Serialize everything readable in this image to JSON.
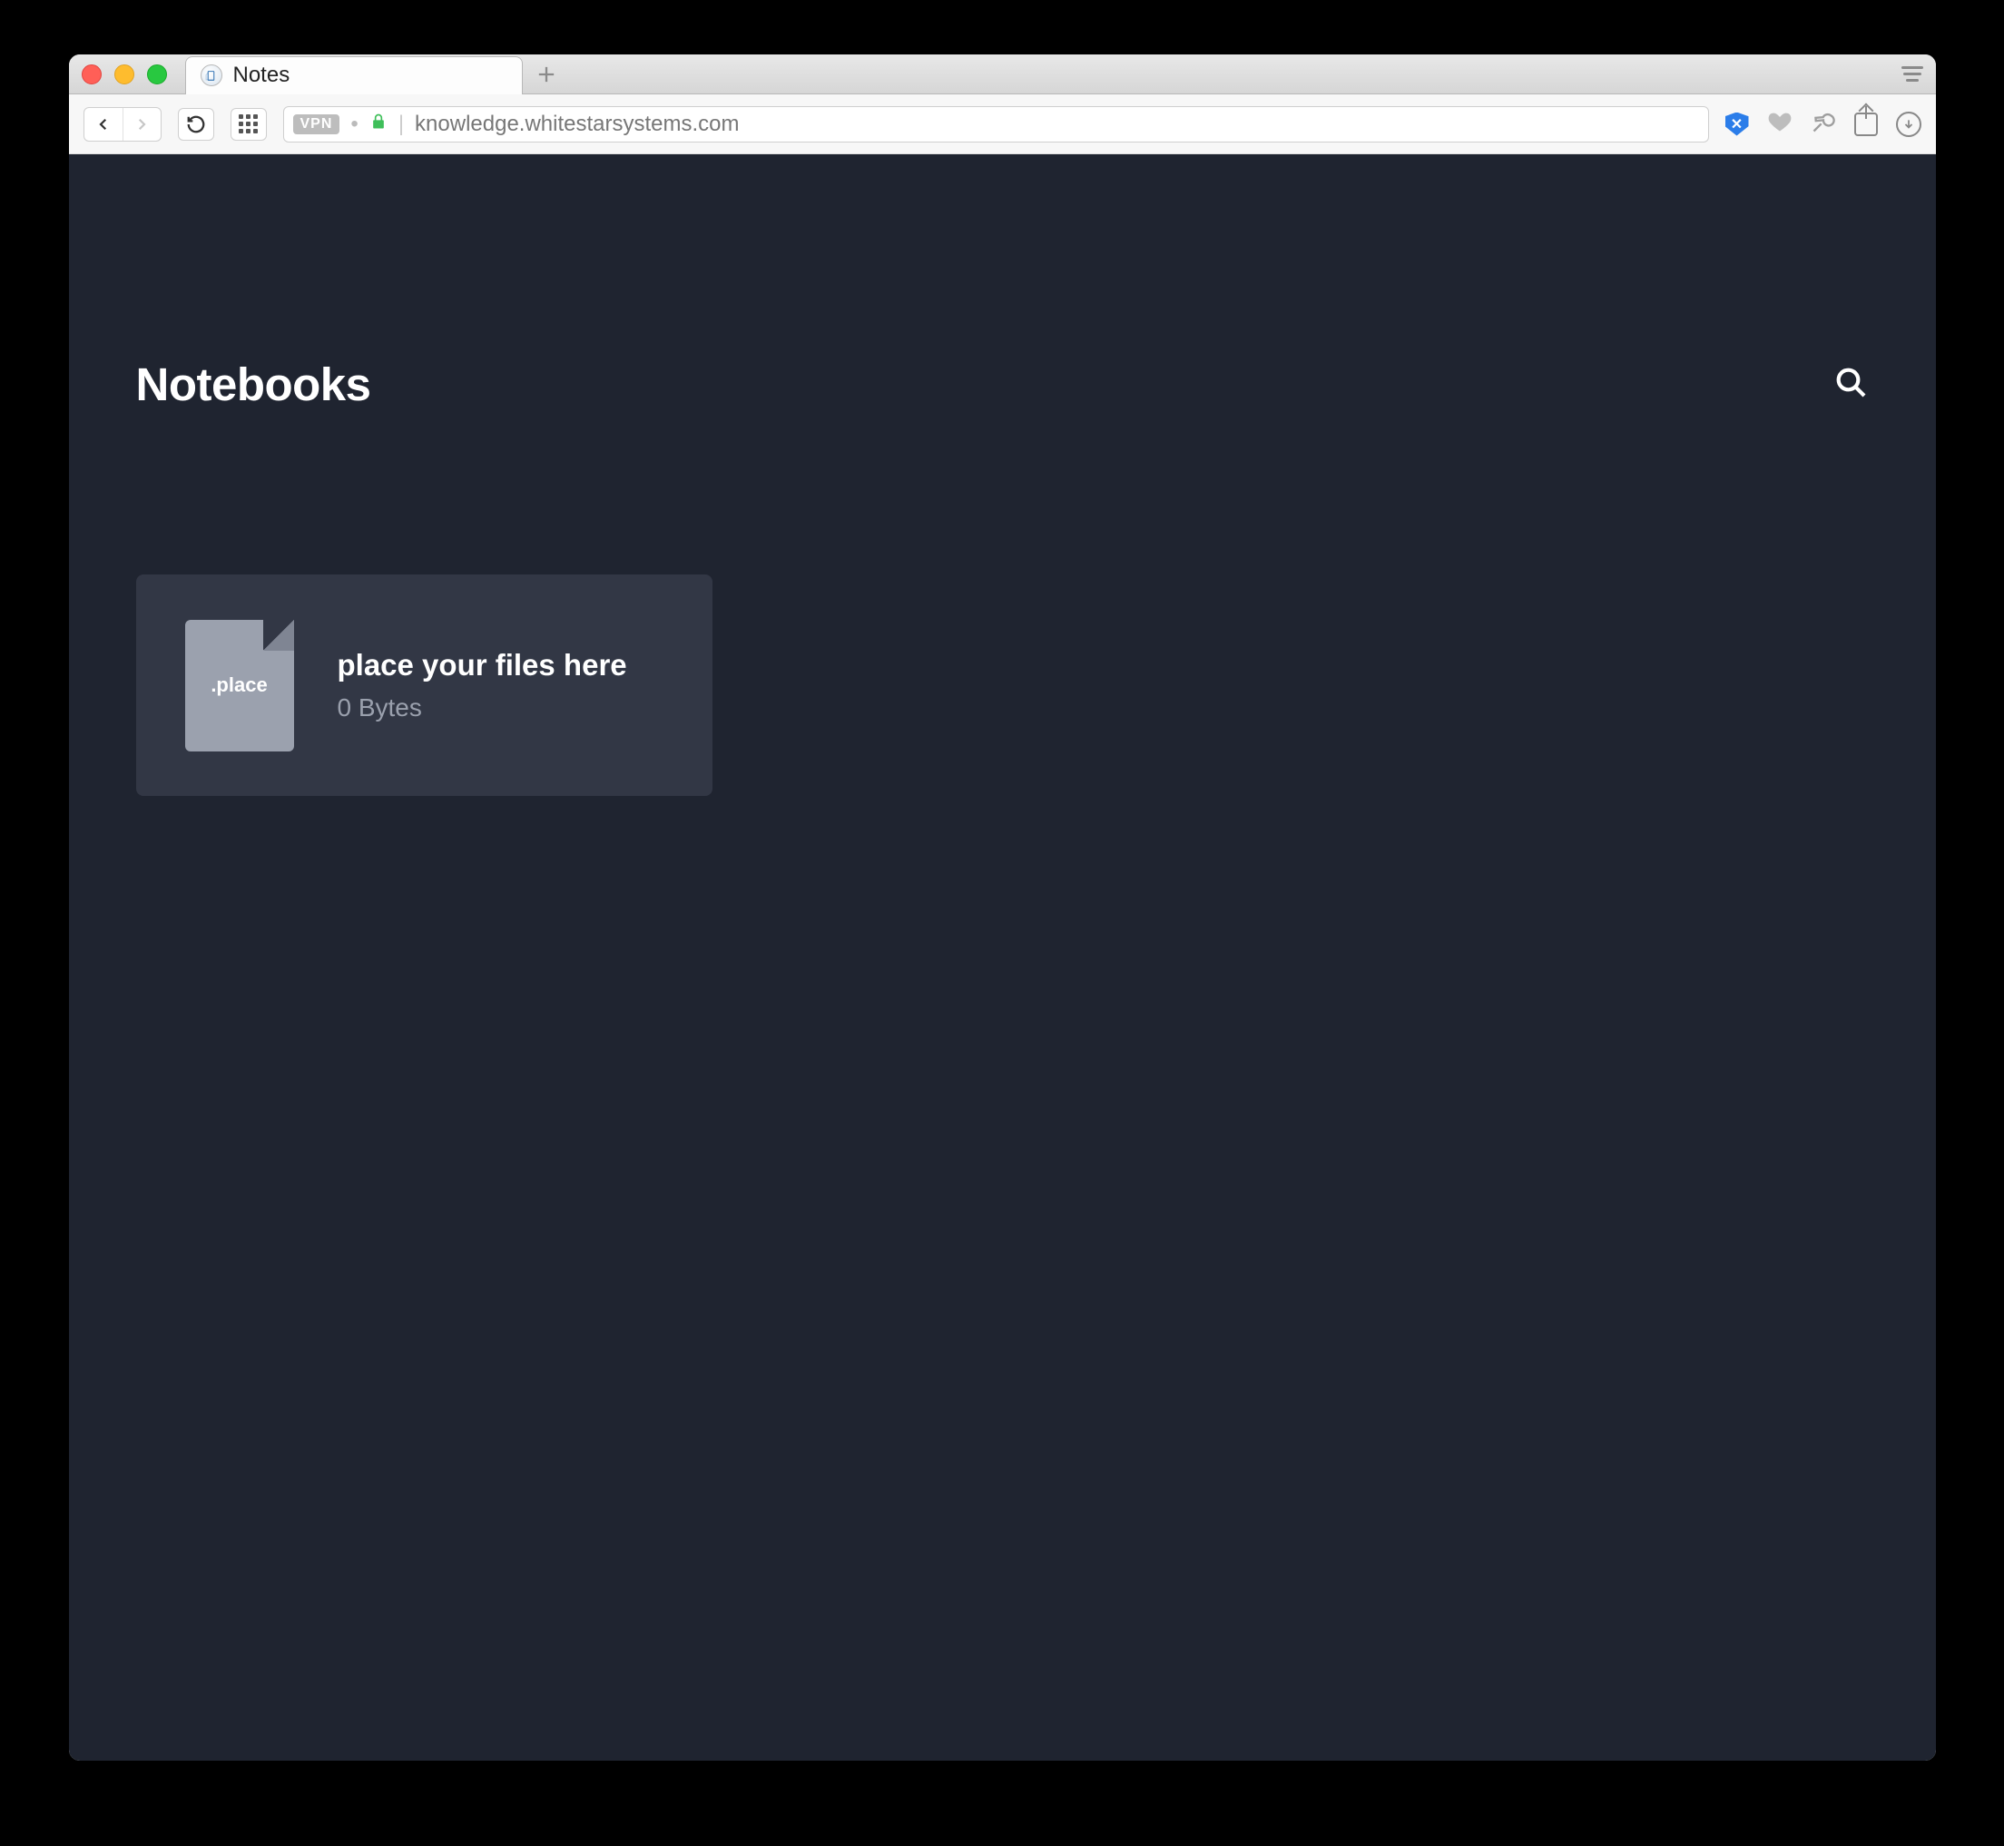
{
  "browser": {
    "tab": {
      "title": "Notes"
    },
    "address_bar": {
      "vpn_label": "VPN",
      "url": "knowledge.whitestarsystems.com"
    }
  },
  "page": {
    "title": "Notebooks"
  },
  "items": [
    {
      "icon_label": ".place",
      "title": "place your files here",
      "subtitle": "0 Bytes"
    }
  ],
  "colors": {
    "page_bg": "#1f2430",
    "card_bg": "#323745",
    "muted_text": "#9aa0ad"
  }
}
